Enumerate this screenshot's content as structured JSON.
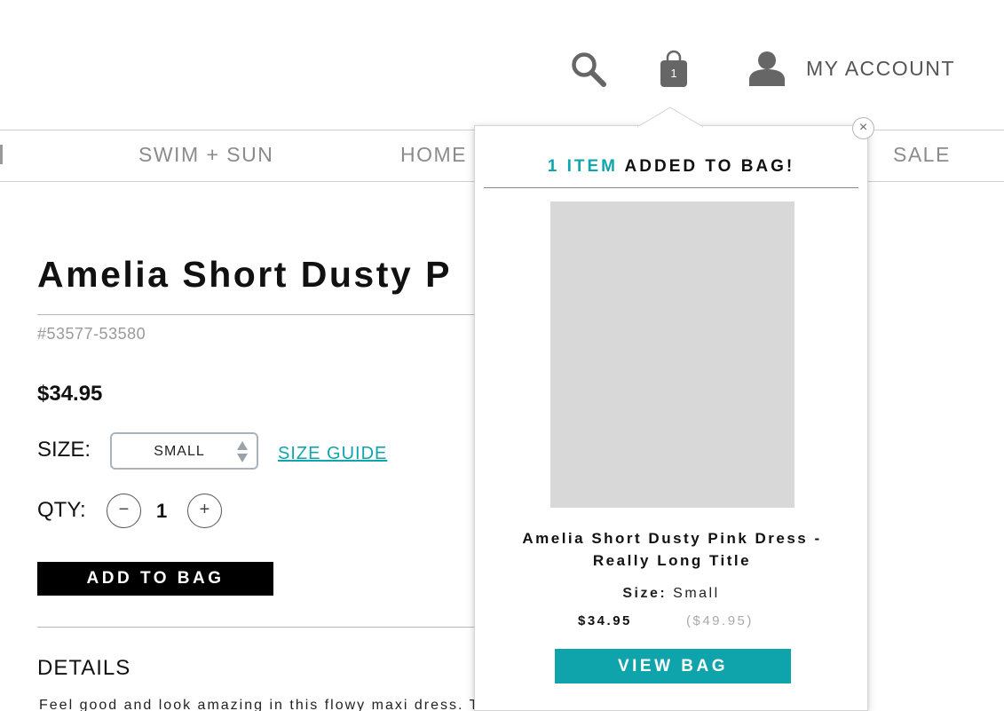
{
  "header": {
    "bag_count": "1",
    "account_label": "MY ACCOUNT"
  },
  "nav": {
    "items": [
      {
        "label": "SWIM + SUN"
      },
      {
        "label": "HOME"
      },
      {
        "label": "SALE"
      }
    ]
  },
  "product": {
    "title": "Amelia Short Dusty P",
    "sku": "#53577-53580",
    "price": "$34.95",
    "size_label": "SIZE:",
    "size_value": "SMALL",
    "size_guide": "SIZE GUIDE",
    "qty_label": "QTY:",
    "qty_value": "1",
    "qty_minus": "−",
    "qty_plus": "+",
    "add_to_bag": "ADD TO BAG",
    "details_heading": "DETAILS",
    "details_text": "Feel good and look amazing in this flowy maxi dress. This lovely dress has a"
  },
  "popup": {
    "close": "×",
    "heading_count": "1 ITEM",
    "heading_rest": "ADDED TO BAG!",
    "product_name": "Amelia Short Dusty Pink Dress - Really Long Title",
    "size_label": "Size:",
    "size_value": "Small",
    "price": "$34.95",
    "original_price": "($49.95)",
    "view_bag": "VIEW BAG"
  },
  "colors": {
    "accent": "#0ea5ad",
    "nav_text": "#8b8b8b",
    "icon": "#666666"
  }
}
